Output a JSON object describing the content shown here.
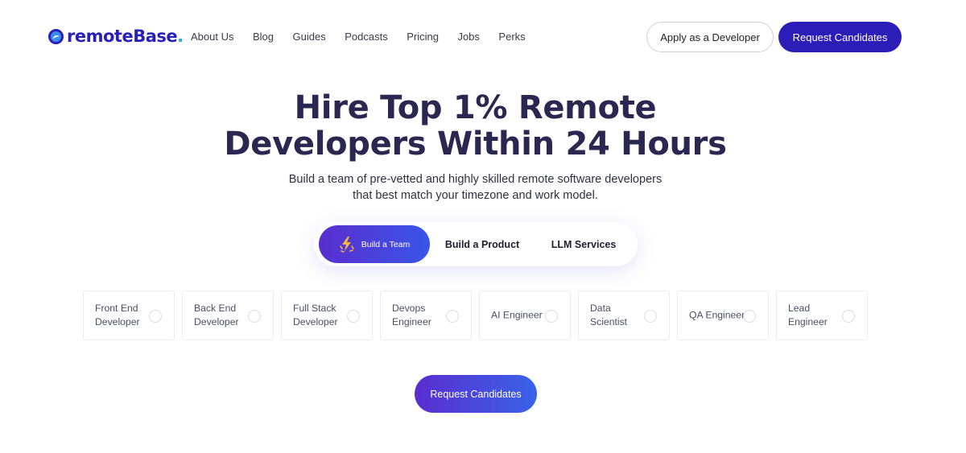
{
  "brand": {
    "name": "remoteBase",
    "dot": ".",
    "primary_color": "#2d1db8",
    "accent_color": "#2fa8e0"
  },
  "nav": {
    "items": [
      {
        "label": "About Us"
      },
      {
        "label": "Blog"
      },
      {
        "label": "Guides"
      },
      {
        "label": "Podcasts"
      },
      {
        "label": "Pricing"
      },
      {
        "label": "Jobs"
      },
      {
        "label": "Perks"
      }
    ]
  },
  "header_actions": {
    "apply_label": "Apply as a Developer",
    "request_label": "Request Candidates"
  },
  "hero": {
    "title_line1": "Hire Top 1% Remote",
    "title_line2": "Developers Within 24 Hours",
    "subtitle_line1": "Build a team of pre-vetted and highly skilled remote software developers",
    "subtitle_line2": "that best match your timezone and work model."
  },
  "service_tabs": {
    "items": [
      {
        "label": "Build a Team",
        "icon": "lightning-icon",
        "active": true
      },
      {
        "label": "Build a Product",
        "active": false
      },
      {
        "label": "LLM Services",
        "active": false
      }
    ]
  },
  "roles": {
    "items": [
      {
        "label": "Front End Developer",
        "selected": false
      },
      {
        "label": "Back End Developer",
        "selected": false
      },
      {
        "label": "Full Stack Developer",
        "selected": false
      },
      {
        "label": "Devops Engineer",
        "selected": false
      },
      {
        "label": "AI Engineer",
        "selected": false
      },
      {
        "label": "Data Scientist",
        "selected": false
      },
      {
        "label": "QA Engineer",
        "selected": false
      },
      {
        "label": "Lead Engineer",
        "selected": false
      }
    ]
  },
  "cta": {
    "request_label": "Request Candidates"
  }
}
